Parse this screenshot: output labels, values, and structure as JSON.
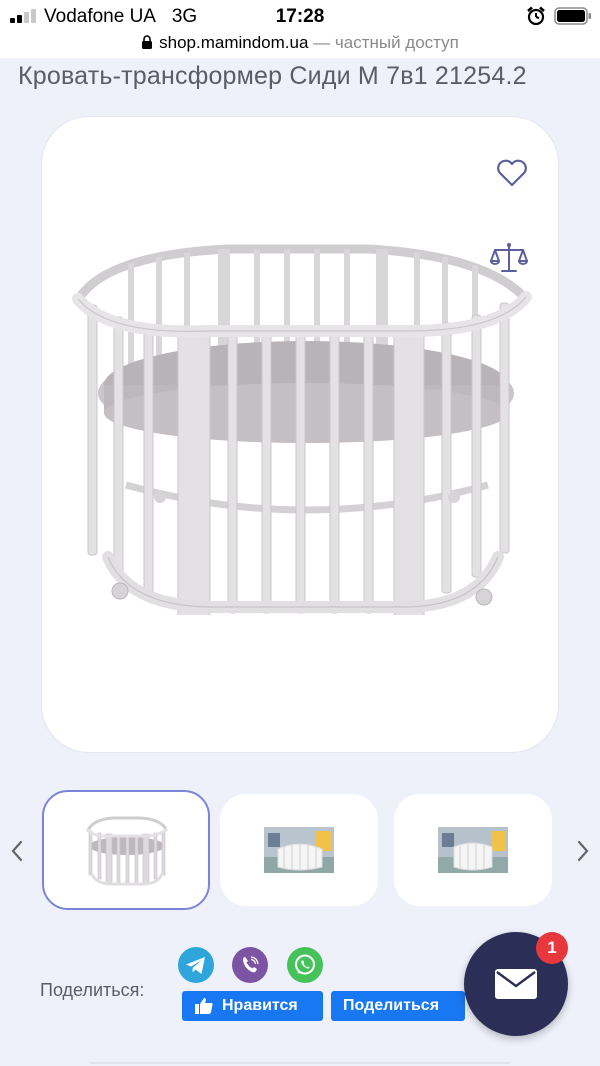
{
  "status_bar": {
    "carrier": "Vodafone UA",
    "network": "3G",
    "time": "17:28"
  },
  "url_bar": {
    "domain": "shop.mamindom.ua",
    "private_label": " — частный доступ"
  },
  "product": {
    "title": "Кровать-трансформер Сиди М 7в1 21254.2"
  },
  "icons": {
    "wishlist": "heart-icon",
    "compare": "scales-icon",
    "prev": "chevron-left-icon",
    "next": "chevron-right-icon",
    "chat": "mail-icon"
  },
  "gallery": {
    "selected_index": 0,
    "thumbnail_count": 3
  },
  "share": {
    "label": "Поделиться:",
    "networks": [
      "telegram",
      "viber",
      "whatsapp"
    ],
    "like_label": "Нравится",
    "share_label": "Поделиться"
  },
  "chat": {
    "badge_count": "1"
  },
  "colors": {
    "accent": "#7b84d8",
    "facebook": "#1877f2",
    "chat_button": "#2b2f57",
    "badge": "#e8383d",
    "telegram": "#2ea6dc",
    "viber": "#7d53a3",
    "whatsapp": "#45c25a"
  }
}
